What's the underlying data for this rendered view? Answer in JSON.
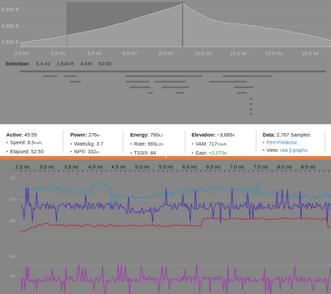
{
  "elevation_chart": {
    "y_ticks": [
      "4,500 ft",
      "4,000 ft",
      "3,500 ft"
    ],
    "x_ticks": [
      "0.0 mi",
      "2.0 mi",
      "4.0 mi",
      "6.0 mi",
      "8.0 mi",
      "10.0 mi",
      "12.0 mi",
      "14.0 mi",
      "16.0 mi"
    ]
  },
  "selection": {
    "label": "Selection",
    "distance": "6.4 mi",
    "elevation": "1,549 ft",
    "grade": "4.5%",
    "time": "52:50"
  },
  "stats": {
    "active": {
      "label": "Active:",
      "value": "45:55",
      "speed_label": "Speed:",
      "speed_value": "8.5",
      "speed_unit": "mi/h",
      "elapsed_label": "Elapsed:",
      "elapsed_value": "52:50"
    },
    "power": {
      "label": "Power:",
      "value": "276",
      "unit": "w",
      "wkg_label": "Watts/kg:",
      "wkg_value": "3.7",
      "np_label": "NP®:",
      "np_value": "332",
      "np_unit": "w"
    },
    "energy": {
      "label": "Energy:",
      "value": "760",
      "unit": "kJ",
      "rate_label": "Rate:",
      "rate_value": "993",
      "rate_unit": "kJ/h",
      "tss_label": "TSS®:",
      "tss_value": "84"
    },
    "elevation": {
      "label": "Elevation:",
      "value": "~3,685",
      "unit": "ft",
      "vam_label": "VAM:",
      "vam_value": "717",
      "vam_unit": "Vm/h",
      "gain_label": "Gain:",
      "gain_value": "+2,073",
      "gain_unit": "ft"
    },
    "data": {
      "label": "Data:",
      "value": "2,767 Samples",
      "perf_link": "Perf Predictor",
      "view_label": "View:",
      "raw_link": "raw",
      "separator": "|",
      "graphs_link": "graphs"
    }
  },
  "resize_handle": "≡",
  "distance_ticks": [
    "2.5 mi",
    "3.0 mi",
    "3.5 mi",
    "4.0 mi",
    "4.5 mi",
    "5.0 mi",
    "5.5 mi",
    "6.0 mi",
    "6.5 mi",
    "7.0 mi",
    "7.5 mi",
    "8.0 mi",
    "8.5 mi"
  ],
  "side_labels": [
    "20.0",
    "10.0",
    "500",
    "",
    "200",
    "",
    "100",
    ""
  ],
  "colors": {
    "accent": "#f07a3c",
    "speed": "#3a8fae",
    "power": "#4a2fb0",
    "heartrate": "#b5284a",
    "cadence": "#a72fb6",
    "link": "#3a86c8",
    "gain": "#2e9e3a"
  }
}
